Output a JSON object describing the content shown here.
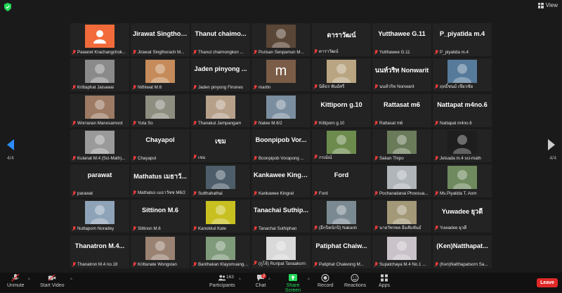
{
  "header": {
    "view_label": "View"
  },
  "pagination": {
    "left": "4/4",
    "right": "4/4"
  },
  "tiles": [
    {
      "name": "",
      "label": "Pawaret Krachangchok...",
      "photo": "icon"
    },
    {
      "name": "Jirawat Singthor...",
      "label": "Jirawat Singthorach M..."
    },
    {
      "name": "Thanut chaimo...",
      "label": "Thanut chaimongkon ..."
    },
    {
      "name": "",
      "label": "Purisan Senpamun M...",
      "photo": "img",
      "color": "#5a4636"
    },
    {
      "name": "ดาราวัฒน์",
      "label": "ดาราวัฒน์"
    },
    {
      "name": "Yutthawee G.11",
      "label": "Yutthawee G.11"
    },
    {
      "name": "P_piyatida m.4",
      "label": "P_piyatida m.4"
    },
    {
      "name": "",
      "label": "Krittaphat Jaisawai",
      "photo": "img",
      "color": "#8a8a8a"
    },
    {
      "name": "",
      "label": "Nithiwat M.6",
      "photo": "img",
      "color": "#c58b5a"
    },
    {
      "name": "Jaden pinyong ...",
      "label": "Jaden pinyong Finones"
    },
    {
      "name": "",
      "label": "martin",
      "photo": "letter",
      "letter": "m"
    },
    {
      "name": "",
      "label": "นิติธร พันธ์ศรี",
      "photo": "img",
      "color": "#b9a582"
    },
    {
      "name": "นนท์วริท Nonwarit",
      "label": "นนท์วริท Nonwarit"
    },
    {
      "name": "",
      "label": "ฤทธิ์ชนม์ เขียวชัย",
      "photo": "img",
      "color": "#567a9a"
    },
    {
      "name": "",
      "label": "Worranan Manosamoot",
      "photo": "img",
      "color": "#9c7a63"
    },
    {
      "name": "",
      "label": "Yuta So",
      "photo": "img",
      "color": "#8d8d80"
    },
    {
      "name": "",
      "label": "Thanakul Jampangam",
      "photo": "img",
      "color": "#b6a08a"
    },
    {
      "name": "",
      "label": "Natee M.6/2",
      "photo": "img",
      "color": "#7b8ea0"
    },
    {
      "name": "Kittiporn g.10",
      "label": "Kittiporn g.10"
    },
    {
      "name": "Rattasat m6",
      "label": "Rattasat m6"
    },
    {
      "name": "Nattapat m4no.6",
      "label": "Nattapat m4no.6"
    },
    {
      "name": "",
      "label": "Kulanat M.4 (Sci-Math)...",
      "photo": "img",
      "color": "#9a9a9a"
    },
    {
      "name": "Chayapol",
      "label": "Chayapol"
    },
    {
      "name": "เขม",
      "label": "เขม"
    },
    {
      "name": "Boonpipob Vor...",
      "label": "Boonpipob Vorapong ..."
    },
    {
      "name": "",
      "label": "กรณ์ณ์",
      "photo": "img",
      "color": "#6c8b4d"
    },
    {
      "name": "",
      "label": "Sakan Thipo",
      "photo": "img",
      "color": "#6a7b5a"
    },
    {
      "name": "",
      "label": "Jetsada m.4 sci-math",
      "photo": "img",
      "color": "#1e1e1e"
    },
    {
      "name": "parawat",
      "label": "parawat"
    },
    {
      "name": "Mathatus เมธาวั...",
      "label": "Mathatus เมธาวัชช M6/2"
    },
    {
      "name": "",
      "label": "Sutthahathai",
      "photo": "img",
      "color": "#4d5e6a"
    },
    {
      "name": "Kankawee Kingr...",
      "label": "Kankawee Kingrat"
    },
    {
      "name": "Ford",
      "label": "Ford"
    },
    {
      "name": "",
      "label": "Pocharadanai Phoosua...",
      "photo": "img",
      "color": "#b0b5ba"
    },
    {
      "name": "",
      "label": "Ms.Piyatida T. Aom",
      "photo": "img",
      "color": "#6f8a5e"
    },
    {
      "name": "",
      "label": "Nuttaporn Noradey",
      "photo": "img",
      "color": "#8fa3b8"
    },
    {
      "name": "Sittinon M.6",
      "label": "Sittinon M.6"
    },
    {
      "name": "",
      "label": "Kanokkul Kate",
      "photo": "img",
      "color": "#c8c020"
    },
    {
      "name": "Tanachai Suthip...",
      "label": "Tanachai Suthiphan"
    },
    {
      "name": "",
      "label": "(อีกปิดนักปิ) Nakarin",
      "photo": "img",
      "color": "#7b8a92"
    },
    {
      "name": "",
      "label": "นายวัชรพล อิ่มสัมพันธ์",
      "photo": "img",
      "color": "#a39878"
    },
    {
      "name": "Yuwadee ยุวดี",
      "label": "Yuwadee ยุวดี"
    },
    {
      "name": "Thanatron M.4...",
      "label": "Thanatron M.4 no.18"
    },
    {
      "name": "",
      "label": "Krittanate Wongstan",
      "photo": "img",
      "color": "#9a8272"
    },
    {
      "name": "",
      "label": "Banthakan Klaysmuang ...",
      "photo": "img",
      "color": "#7f9a7a"
    },
    {
      "name": "",
      "label": "(กูโจ้) Ruripat Tanaakorn",
      "photo": "img",
      "color": "#d9d9d9"
    },
    {
      "name": "Patiphat Chaiw...",
      "label": "Patiphat Chaiwong M..."
    },
    {
      "name": "",
      "label": "Supatchaya M.4 No.1 ...",
      "photo": "img",
      "color": "#c9c2c8"
    },
    {
      "name": "(Ken)Natthapat...",
      "label": "(Ken)Natthapatsorn Sa..."
    }
  ],
  "toolbar": {
    "unmute": "Unmute",
    "start_video": "Start Video",
    "participants": "Participants",
    "participants_count": "163",
    "chat": "Chat",
    "chat_badge": "2",
    "share_screen": "Share Screen",
    "record": "Record",
    "reactions": "Reactions",
    "apps": "Apps",
    "leave": "Leave"
  },
  "colors": {
    "accent": "#2d8cff",
    "leave": "#e02828",
    "share": "#23d959"
  }
}
